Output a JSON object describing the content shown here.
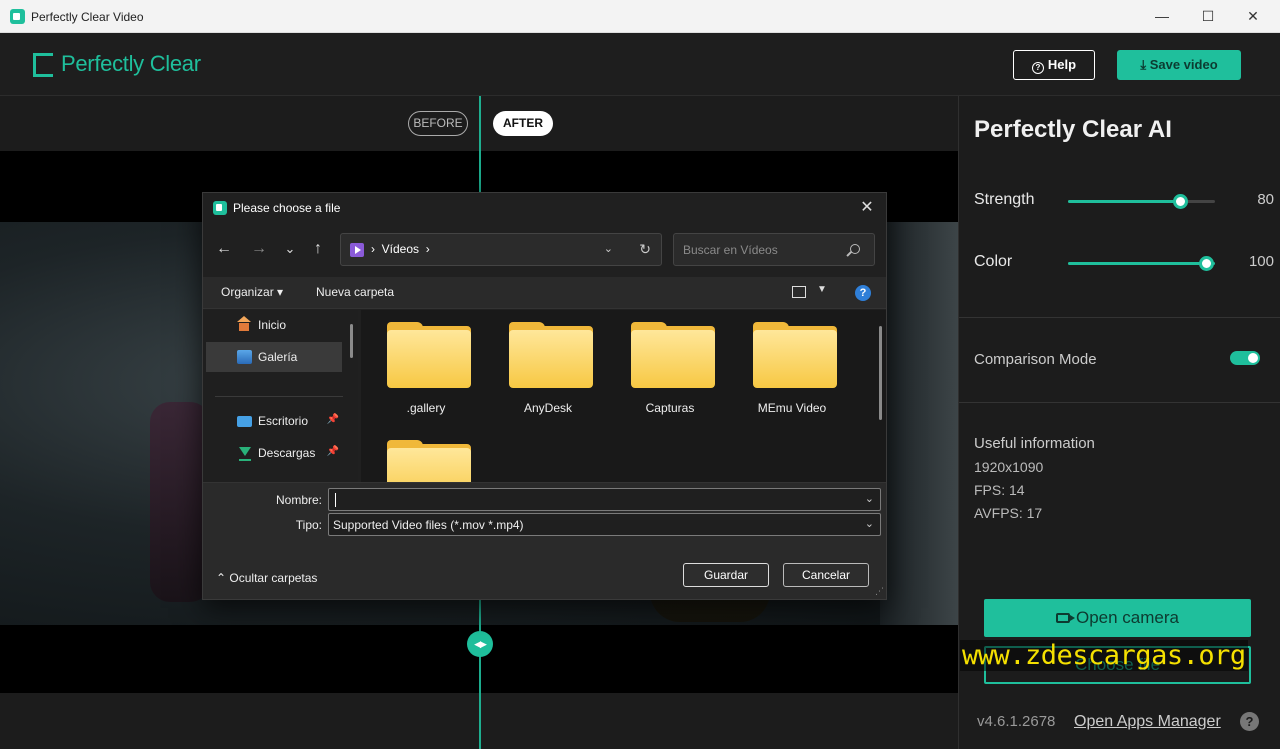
{
  "window": {
    "title": "Perfectly Clear Video",
    "minimize": "—",
    "maximize": "☐",
    "close": "✕"
  },
  "header": {
    "logo_text": "Perfectly Clear",
    "help_label": "Help",
    "save_label": "Save video"
  },
  "preview": {
    "before_label": "BEFORE",
    "after_label": "AFTER",
    "divider_position": 0.5
  },
  "panel": {
    "title": "Perfectly Clear AI",
    "strength": {
      "label": "Strength",
      "value": "80",
      "fraction": 0.8
    },
    "color": {
      "label": "Color",
      "value": "100",
      "fraction": 1.0
    },
    "comparison_mode": {
      "label": "Comparison Mode",
      "enabled": true
    },
    "info": {
      "heading": "Useful information",
      "resolution": "1920x1090",
      "fps": "FPS: 14",
      "avfps": "AVFPS: 17"
    },
    "open_camera_label": "Open camera",
    "choose_file_label": "Choose file",
    "version": "v4.6.1.2678",
    "apps_manager_label": "Open Apps Manager",
    "help_glyph": "?"
  },
  "watermark": "www.zdescargas.org",
  "dialog": {
    "title": "Please choose a file",
    "close": "✕",
    "nav": {
      "back": "←",
      "forward": "→",
      "recent": "⌄",
      "up": "↑"
    },
    "address": {
      "folder": "Vídeos",
      "sep": "›"
    },
    "search_placeholder": "Buscar en Vídeos",
    "toolbar": {
      "organize": "Organizar ▾",
      "new_folder": "Nueva carpeta",
      "help": "?"
    },
    "sidebar": [
      {
        "label": "Inicio",
        "pinned": false
      },
      {
        "label": "Galería",
        "pinned": false,
        "selected": true
      },
      {
        "label": "Escritorio",
        "pinned": true
      },
      {
        "label": "Descargas",
        "pinned": true
      }
    ],
    "folders": [
      ".gallery",
      "AnyDesk",
      "Capturas",
      "MEmu Video",
      ""
    ],
    "filename": {
      "label": "Nombre:",
      "value": ""
    },
    "filetype": {
      "label": "Tipo:",
      "value": "Supported Video files (*.mov *.mp4)"
    },
    "hide_folders_label": "Ocultar carpetas",
    "save_label": "Guardar",
    "cancel_label": "Cancelar"
  }
}
